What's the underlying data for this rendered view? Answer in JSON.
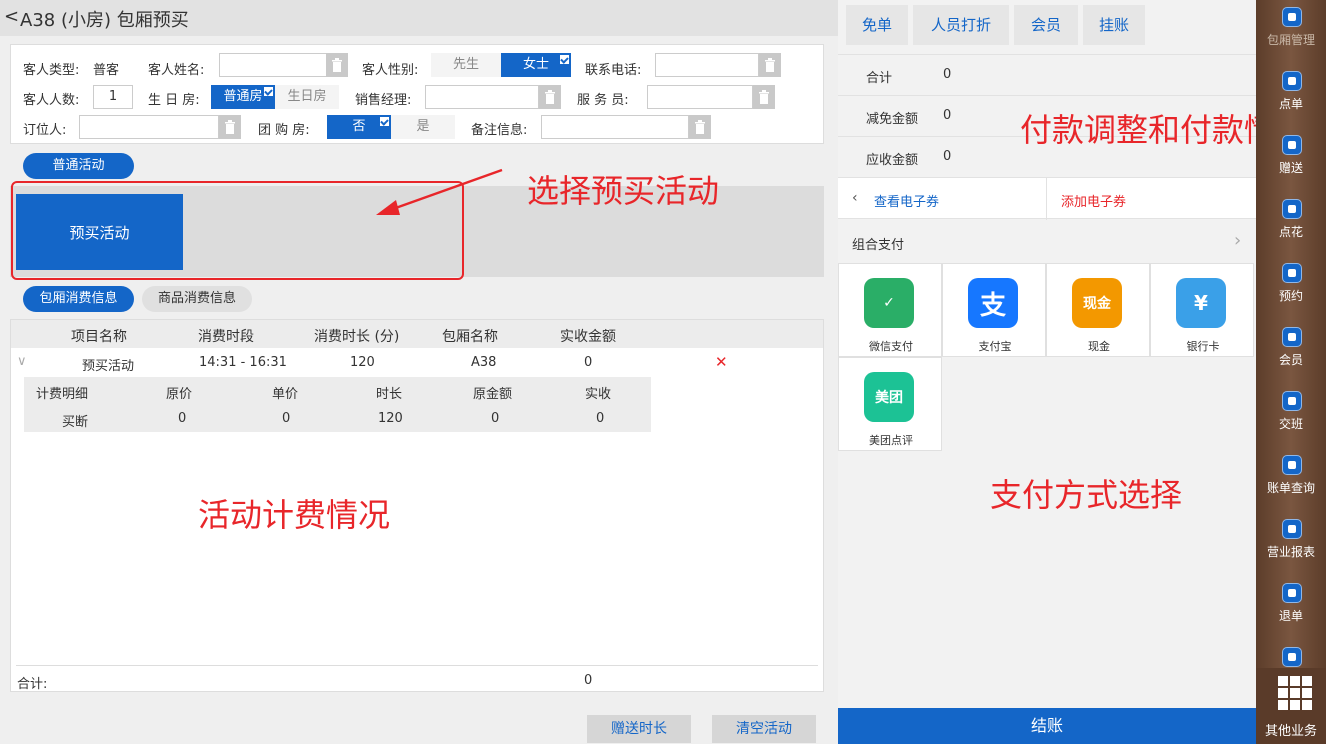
{
  "header": {
    "back_glyph": "<",
    "title": "A38 (小房) 包厢预买"
  },
  "form": {
    "guest_type_label": "客人类型:",
    "guest_type_value": "普客",
    "guest_name_label": "客人姓名:",
    "guest_name_value": "",
    "gender_label": "客人性别:",
    "gender_options": [
      "先生",
      "女士"
    ],
    "gender_selected": "女士",
    "phone_label": "联系电话:",
    "phone_value": "",
    "guest_count_label": "客人人数:",
    "guest_count_value": "1",
    "birthday_label": "生 日 房:",
    "birthday_options": [
      "普通房",
      "生日房"
    ],
    "birthday_selected": "普通房",
    "sales_manager_label": "销售经理:",
    "sales_manager_value": "",
    "attendant_label": "服 务 员:",
    "attendant_value": "",
    "booker_label": "订位人:",
    "booker_value": "",
    "group_label": "团 购 房:",
    "group_options": [
      "否",
      "是"
    ],
    "group_selected": "否",
    "remark_label": "备注信息:",
    "remark_value": ""
  },
  "activity": {
    "normal_tab": "普通活动",
    "prepay_card": "预买活动"
  },
  "annotations": {
    "select_prepay": "选择预买活动",
    "billing": "活动计费情况",
    "payment_adjust": "付款调整和付款情况",
    "payment_method": "支付方式选择"
  },
  "consumption_tabs": [
    "包厢消费信息",
    "商品消费信息"
  ],
  "table": {
    "headers": [
      "项目名称",
      "消费时段",
      "消费时长 (分)",
      "包厢名称",
      "实收金额"
    ],
    "row": {
      "expand_glyph": "∨",
      "name": "预买活动",
      "period": "14:31 - 16:31",
      "duration": "120",
      "room": "A38",
      "amount": "0",
      "delete_glyph": "✕"
    },
    "sub_headers": [
      "计费明细",
      "原价",
      "单价",
      "时长",
      "原金额",
      "实收"
    ],
    "sub_row": [
      "买断",
      "0",
      "0",
      "120",
      "0",
      "0"
    ],
    "total_label": "合计:",
    "total_value": "0"
  },
  "bottom_buttons": {
    "gift_time": "赠送时长",
    "clear_activity": "清空活动"
  },
  "right": {
    "top_buttons": [
      "免单",
      "人员打折",
      "会员",
      "挂账"
    ],
    "summary": [
      {
        "label": "合计",
        "value": "0"
      },
      {
        "label": "减免金额",
        "value": "0"
      },
      {
        "label": "应收金额",
        "value": "0"
      }
    ],
    "view_coupon": "查看电子券",
    "add_coupon": "添加电子券",
    "combo_pay": "组合支付",
    "payments": [
      {
        "label": "微信支付",
        "icon": "wechat-pay-icon",
        "color": "#2aae67",
        "glyph": "✓"
      },
      {
        "label": "支付宝",
        "icon": "alipay-icon",
        "color": "#1677ff",
        "glyph": "支"
      },
      {
        "label": "现金",
        "icon": "cash-icon",
        "color": "#f39800",
        "glyph": "现金"
      },
      {
        "label": "银行卡",
        "icon": "bank-card-icon",
        "color": "#3aa0e8",
        "glyph": "¥"
      },
      {
        "label": "美团点评",
        "icon": "meituan-icon",
        "color": "#1cc295",
        "glyph": "美团"
      }
    ],
    "checkout": "结账"
  },
  "sidebar": {
    "items": [
      "包厢管理",
      "点单",
      "赠送",
      "点花",
      "预约",
      "会员",
      "交班",
      "账单查询",
      "营业报表",
      "退单"
    ],
    "more": "其他业务"
  },
  "colors": {
    "accent": "#1466c8",
    "annotation": "#e8262a",
    "sidebar": "#6b4a35"
  }
}
